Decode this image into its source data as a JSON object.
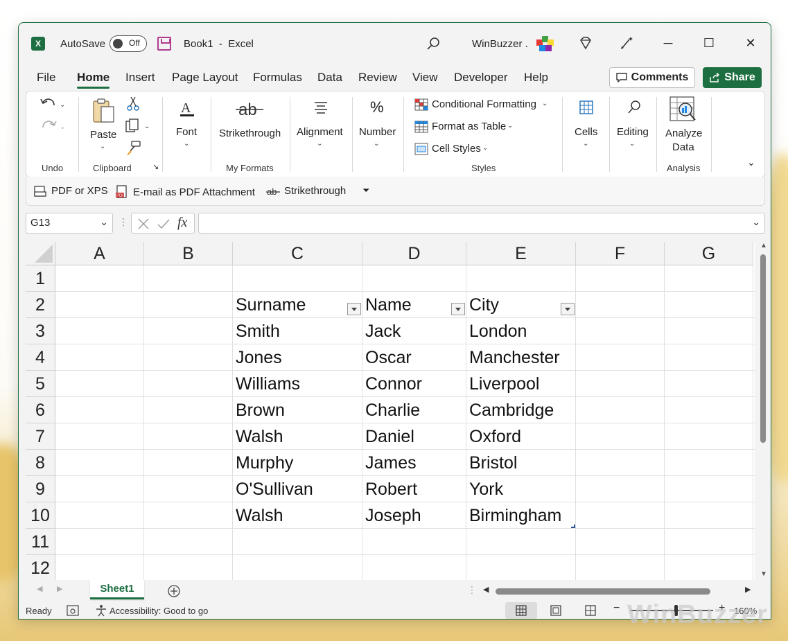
{
  "app": {
    "autosave_label": "AutoSave",
    "autosave_state": "Off",
    "title": "Book1  -  Excel",
    "user": "WinBuzzer ."
  },
  "menu": {
    "tabs": [
      "File",
      "Home",
      "Insert",
      "Page Layout",
      "Formulas",
      "Data",
      "Review",
      "View",
      "Developer",
      "Help"
    ],
    "active": "Home",
    "comments": "Comments",
    "share": "Share"
  },
  "ribbon": {
    "undo_group": "Undo",
    "paste": "Paste",
    "clipboard_group": "Clipboard",
    "font": "Font",
    "strikethrough": "Strikethrough",
    "my_formats_group": "My Formats",
    "alignment": "Alignment",
    "number": "Number",
    "conditional_formatting": "Conditional Formatting",
    "format_as_table": "Format as Table",
    "cell_styles": "Cell Styles",
    "styles_group": "Styles",
    "cells": "Cells",
    "editing": "Editing",
    "analyze_data_1": "Analyze",
    "analyze_data_2": "Data",
    "analysis_group": "Analysis"
  },
  "qat": {
    "pdf_xps": "PDF or XPS",
    "email_pdf": "E-mail as PDF Attachment",
    "strikethrough": "Strikethrough"
  },
  "formula_bar": {
    "name_box": "G13",
    "fx": "fx",
    "formula": ""
  },
  "sheet": {
    "columns": [
      "A",
      "B",
      "C",
      "D",
      "E",
      "F",
      "G"
    ],
    "rows": [
      "1",
      "2",
      "3",
      "4",
      "5",
      "6",
      "7",
      "8",
      "9",
      "10",
      "11",
      "12"
    ],
    "headers": [
      "Surname",
      "Name",
      "City"
    ],
    "data": [
      [
        "Smith",
        "Jack",
        "London"
      ],
      [
        "Jones",
        "Oscar",
        "Manchester"
      ],
      [
        "Williams",
        "Connor",
        "Liverpool"
      ],
      [
        "Brown",
        "Charlie",
        "Cambridge"
      ],
      [
        "Walsh",
        "Daniel",
        "Oxford"
      ],
      [
        "Murphy",
        "James",
        "Bristol"
      ],
      [
        "O'Sullivan",
        "Robert",
        "York"
      ],
      [
        "Walsh",
        "Joseph",
        "Birmingham"
      ]
    ],
    "tab_name": "Sheet1"
  },
  "status": {
    "ready": "Ready",
    "accessibility": "Accessibility: Good to go",
    "zoom": "160%"
  },
  "colors": {
    "accent": "#1d6f42",
    "share_bg": "#1d6f42"
  },
  "watermark": "WinBuzzer"
}
